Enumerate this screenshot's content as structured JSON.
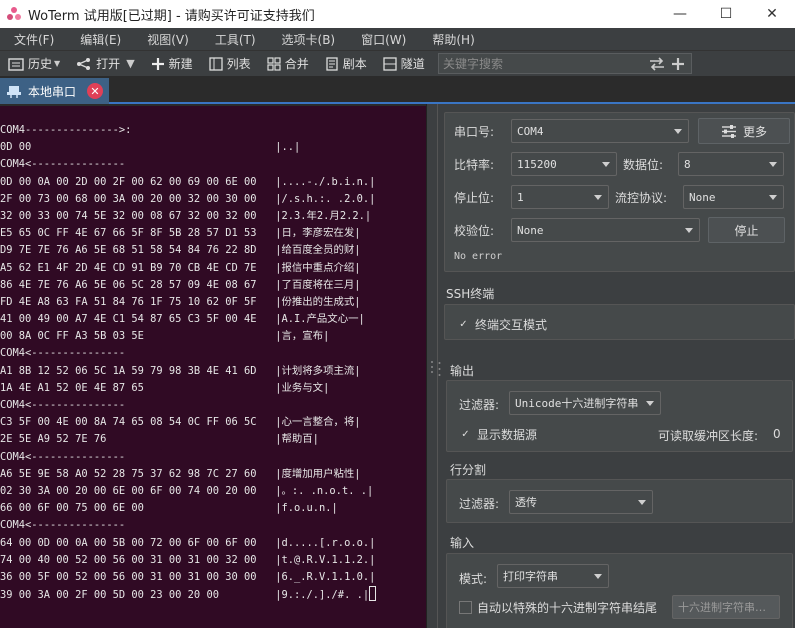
{
  "window": {
    "title": "WoTerm 试用版[已过期] - 请购买许可证支持我们",
    "minimize": "—",
    "maximize": "☐",
    "close": "✕"
  },
  "menu": [
    "文件(F)",
    "编辑(E)",
    "视图(V)",
    "工具(T)",
    "选项卡(B)",
    "窗口(W)",
    "帮助(H)"
  ],
  "toolbar": {
    "history": "历史",
    "open": "打开",
    "new": "新建",
    "list": "列表",
    "merge": "合并",
    "script": "剧本",
    "tunnel": "隧道",
    "search_placeholder": "关键字搜索"
  },
  "tab": {
    "label": "本地串口",
    "close": "✕"
  },
  "terminal": {
    "lines": [
      "COM4--------------->:",
      "0D 00                                       |..|",
      "COM4<---------------",
      "0D 00 0A 00 2D 00 2F 00 62 00 69 00 6E 00   |....-./.b.i.n.|",
      "2F 00 73 00 68 00 3A 00 20 00 32 00 30 00   |/.s.h.:. .2.0.|",
      "32 00 33 00 74 5E 32 00 08 67 32 00 32 00   |2.3.年2.月2.2.|",
      "E5 65 0C FF 4E 67 66 5F 8F 5B 28 57 D1 53   |日，李彦宏在发|",
      "D9 7E 7E 76 A6 5E 68 51 58 54 84 76 22 8D   |给百度全员的财|",
      "A5 62 E1 4F 2D 4E CD 91 B9 70 CB 4E CD 7E   |报信中重点介绍|",
      "86 4E 7E 76 A6 5E 06 5C 28 57 09 4E 08 67   |了百度将在三月|",
      "FD 4E A8 63 FA 51 84 76 1F 75 10 62 0F 5F   |份推出的生成式|",
      "41 00 49 00 A7 4E C1 54 87 65 C3 5F 00 4E   |A.I.产品文心一|",
      "00 8A 0C FF A3 5B 03 5E                     |言，宣布|",
      "COM4<---------------",
      "A1 8B 12 52 06 5C 1A 59 79 98 3B 4E 41 6D   |计划将多项主流|",
      "1A 4E A1 52 0E 4E 87 65                     |业务与文|",
      "COM4<---------------",
      "C3 5F 00 4E 00 8A 74 65 08 54 0C FF 06 5C   |心一言整合，将|",
      "2E 5E A9 52 7E 76                           |帮助百|",
      "COM4<---------------",
      "A6 5E 9E 58 A0 52 28 75 37 62 98 7C 27 60   |度增加用户粘性|",
      "02 30 3A 00 20 00 6E 00 6F 00 74 00 20 00   |。:. .n.o.t. .|",
      "66 00 6F 00 75 00 6E 00                     |f.o.u.n.|",
      "COM4<---------------",
      "64 00 0D 00 0A 00 5B 00 72 00 6F 00 6F 00   |d.....[.r.o.o.|",
      "74 00 40 00 52 00 56 00 31 00 31 00 32 00   |t.@.R.V.1.1.2.|",
      "36 00 5F 00 52 00 56 00 31 00 31 00 30 00   |6._.R.V.1.1.0.|",
      "39 00 3A 00 2F 00 5D 00 23 00 20 00         |9.:./.]./#. .|"
    ]
  },
  "serial": {
    "port_label": "串口号:",
    "port_value": "COM4",
    "more_button": "更多",
    "baud_label": "比特率:",
    "baud_value": "115200",
    "databits_label": "数据位:",
    "databits_value": "8",
    "stopbits_label": "停止位:",
    "stopbits_value": "1",
    "flow_label": "流控协议:",
    "flow_value": "None",
    "parity_label": "校验位:",
    "parity_value": "None",
    "stop_button": "停止",
    "status": "No error"
  },
  "ssh": {
    "title": "SSH终端",
    "interactive_label": "终端交互模式",
    "interactive_checked": "✓"
  },
  "output": {
    "title": "输出",
    "filter_label": "过滤器:",
    "filter_value": "Unicode十六进制字符串",
    "show_source_label": "显示数据源",
    "show_source_checked": "✓",
    "buffer_label": "可读取缓冲区长度:",
    "buffer_value": "0"
  },
  "line_split": {
    "title": "行分割",
    "filter_label": "过滤器:",
    "filter_value": "透传"
  },
  "input": {
    "title": "输入",
    "mode_label": "模式:",
    "mode_value": "打印字符串",
    "auto_end_label": "自动以特殊的十六进制字符串结尾",
    "hex_placeholder": "十六进制字符串…"
  }
}
